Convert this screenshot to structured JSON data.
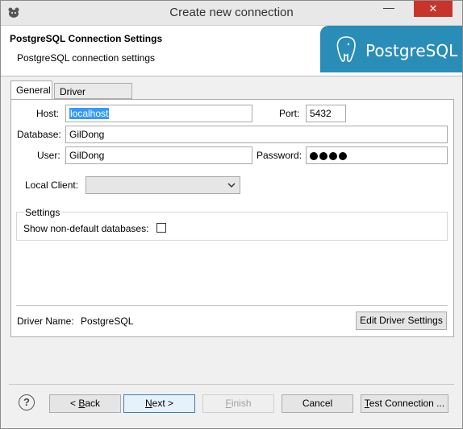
{
  "window": {
    "title": "Create new connection",
    "minimize_glyph": "—",
    "close_glyph": "✕"
  },
  "header": {
    "title": "PostgreSQL Connection Settings",
    "description": "PostgreSQL connection settings",
    "logo_text": "PostgreSQL"
  },
  "tabs": [
    {
      "label": "General",
      "active": true
    },
    {
      "label": "Driver properties",
      "active": false
    }
  ],
  "form": {
    "host_label": "Host:",
    "host_value": "localhost",
    "port_label": "Port:",
    "port_value": "5432",
    "database_label": "Database:",
    "database_value": "GilDong",
    "user_label": "User:",
    "user_value": "GilDong",
    "password_label": "Password:",
    "password_mask_count": 4,
    "local_client_label": "Local Client:",
    "local_client_value": ""
  },
  "settings": {
    "group_title": "Settings",
    "show_non_default_label": "Show non-default databases:",
    "show_non_default_checked": false
  },
  "driver": {
    "name_label": "Driver Name:",
    "name_value": "PostgreSQL",
    "edit_button": "Edit Driver Settings"
  },
  "buttons": {
    "help": "?",
    "back_prefix": "< ",
    "back_mnemonic": "B",
    "back_rest": "ack",
    "next_mnemonic": "N",
    "next_rest": "ext >",
    "finish_mnemonic": "F",
    "finish_rest": "inish",
    "cancel": "Cancel",
    "test_mnemonic": "T",
    "test_rest": "est Connection ..."
  },
  "colors": {
    "logo_banner": "#2a8db8",
    "close_button": "#c7342b",
    "selection": "#3399ff"
  }
}
